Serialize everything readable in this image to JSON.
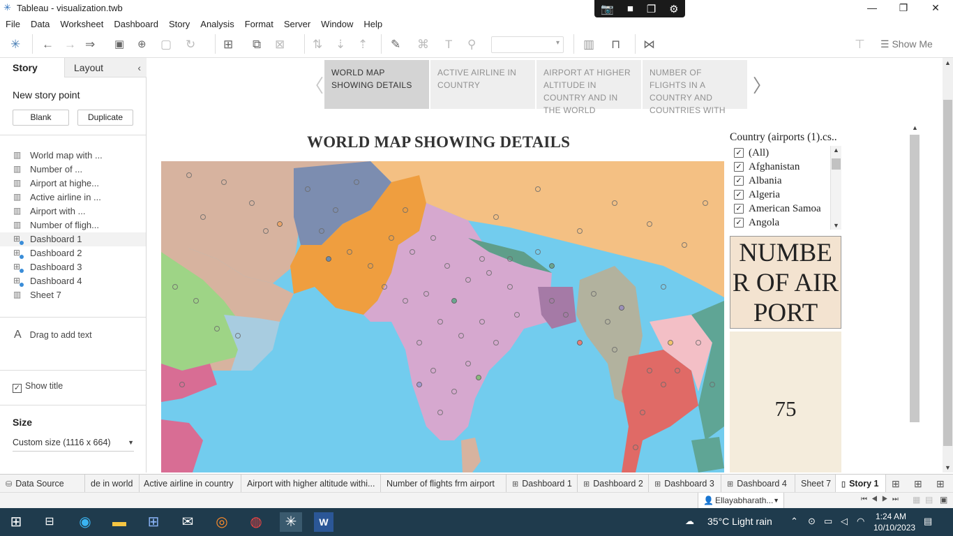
{
  "window": {
    "title": "Tableau - visualization.twb"
  },
  "menu": [
    "File",
    "Data",
    "Worksheet",
    "Dashboard",
    "Story",
    "Analysis",
    "Format",
    "Server",
    "Window",
    "Help"
  ],
  "toolbar": {
    "show_me": "Show Me"
  },
  "left_panel": {
    "tab_story": "Story",
    "tab_layout": "Layout",
    "new_story_point": "New story point",
    "btn_blank": "Blank",
    "btn_duplicate": "Duplicate",
    "sheets": [
      {
        "label": "World map with ...",
        "type": "sheet"
      },
      {
        "label": "Number of ...",
        "type": "sheet"
      },
      {
        "label": "Airport at highe...",
        "type": "sheet"
      },
      {
        "label": "Active airline in ...",
        "type": "sheet"
      },
      {
        "label": "Airport with ...",
        "type": "sheet"
      },
      {
        "label": "Number of fligh...",
        "type": "sheet"
      },
      {
        "label": "Dashboard 1",
        "type": "dashboard",
        "selected": true
      },
      {
        "label": "Dashboard 2",
        "type": "dashboard"
      },
      {
        "label": "Dashboard 3",
        "type": "dashboard"
      },
      {
        "label": "Dashboard 4",
        "type": "dashboard"
      },
      {
        "label": "Sheet 7",
        "type": "sheet"
      }
    ],
    "drag_text": "Drag to add text",
    "show_title": "Show title",
    "size_label": "Size",
    "size_value": "Custom size (1116 x 664)"
  },
  "story_points": [
    "WORLD MAP SHOWING DETAILS",
    "ACTIVE AIRLINE IN COUNTRY",
    "AIRPORT AT HIGHER ALTITUDE IN COUNTRY AND IN THE WORLD",
    "NUMBER OF FLIGHTS IN A COUNTRY AND COUNTRIES WITH"
  ],
  "dashboard": {
    "title": "WORLD MAP SHOWING DETAILS",
    "filter": {
      "title": "Country (airports (1).cs..",
      "items": [
        "(All)",
        "Afghanistan",
        "Albania",
        "Algeria",
        "American Samoa",
        "Angola"
      ]
    },
    "kpi_header": "NUMBER OF AIRPORT",
    "kpi_value": "75"
  },
  "sheet_tabs": [
    {
      "label": "Data Source",
      "icon": "datasource"
    },
    {
      "label": "de in world",
      "icon": ""
    },
    {
      "label": "Active airline in country",
      "icon": ""
    },
    {
      "label": "Airport with higher altitude withi...",
      "icon": ""
    },
    {
      "label": "Number of flights frm airport",
      "icon": ""
    },
    {
      "label": "Dashboard 1",
      "icon": "dashboard"
    },
    {
      "label": "Dashboard 2",
      "icon": "dashboard"
    },
    {
      "label": "Dashboard 3",
      "icon": "dashboard"
    },
    {
      "label": "Dashboard 4",
      "icon": "dashboard"
    },
    {
      "label": "Sheet 7",
      "icon": ""
    },
    {
      "label": "Story 1",
      "icon": "story",
      "active": true
    }
  ],
  "status": {
    "user": "Ellayabharath..."
  },
  "taskbar": {
    "weather": "35°C  Light rain",
    "time": "1:24 AM",
    "date": "10/10/2023"
  }
}
